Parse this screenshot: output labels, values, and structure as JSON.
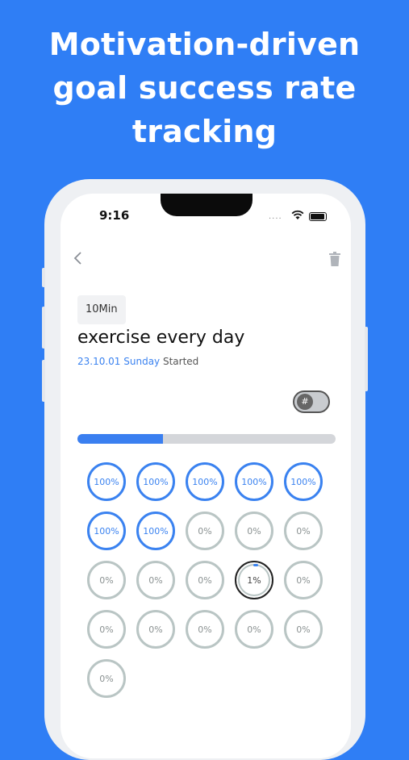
{
  "headline": {
    "line1": "Motivation-driven",
    "line2": "goal success rate",
    "line3": "tracking"
  },
  "status_bar": {
    "time": "9:16",
    "signal_text": "····"
  },
  "nav": {
    "back_icon": "chevron-left-icon",
    "delete_icon": "trash-icon"
  },
  "goal": {
    "duration": "10Min",
    "title": "exercise every day",
    "start_date": "23.10.01 Sunday",
    "start_label": "Started"
  },
  "toggle": {
    "symbol": "#",
    "on": false
  },
  "progress": {
    "fraction": 0.33
  },
  "cells": [
    {
      "label": "100%",
      "state": "done"
    },
    {
      "label": "100%",
      "state": "done"
    },
    {
      "label": "100%",
      "state": "done"
    },
    {
      "label": "100%",
      "state": "done"
    },
    {
      "label": "100%",
      "state": "done"
    },
    {
      "label": "100%",
      "state": "done"
    },
    {
      "label": "100%",
      "state": "done"
    },
    {
      "label": "0%",
      "state": "empty"
    },
    {
      "label": "0%",
      "state": "empty"
    },
    {
      "label": "0%",
      "state": "empty"
    },
    {
      "label": "0%",
      "state": "empty"
    },
    {
      "label": "0%",
      "state": "empty"
    },
    {
      "label": "0%",
      "state": "empty"
    },
    {
      "label": "1%",
      "state": "current"
    },
    {
      "label": "0%",
      "state": "empty"
    },
    {
      "label": "0%",
      "state": "empty"
    },
    {
      "label": "0%",
      "state": "empty"
    },
    {
      "label": "0%",
      "state": "empty"
    },
    {
      "label": "0%",
      "state": "empty"
    },
    {
      "label": "0%",
      "state": "empty"
    },
    {
      "label": "0%",
      "state": "empty"
    }
  ],
  "colors": {
    "brand_blue": "#2f7ef5",
    "done_ring": "#3a82f0",
    "empty_ring": "#b9c5c4"
  }
}
